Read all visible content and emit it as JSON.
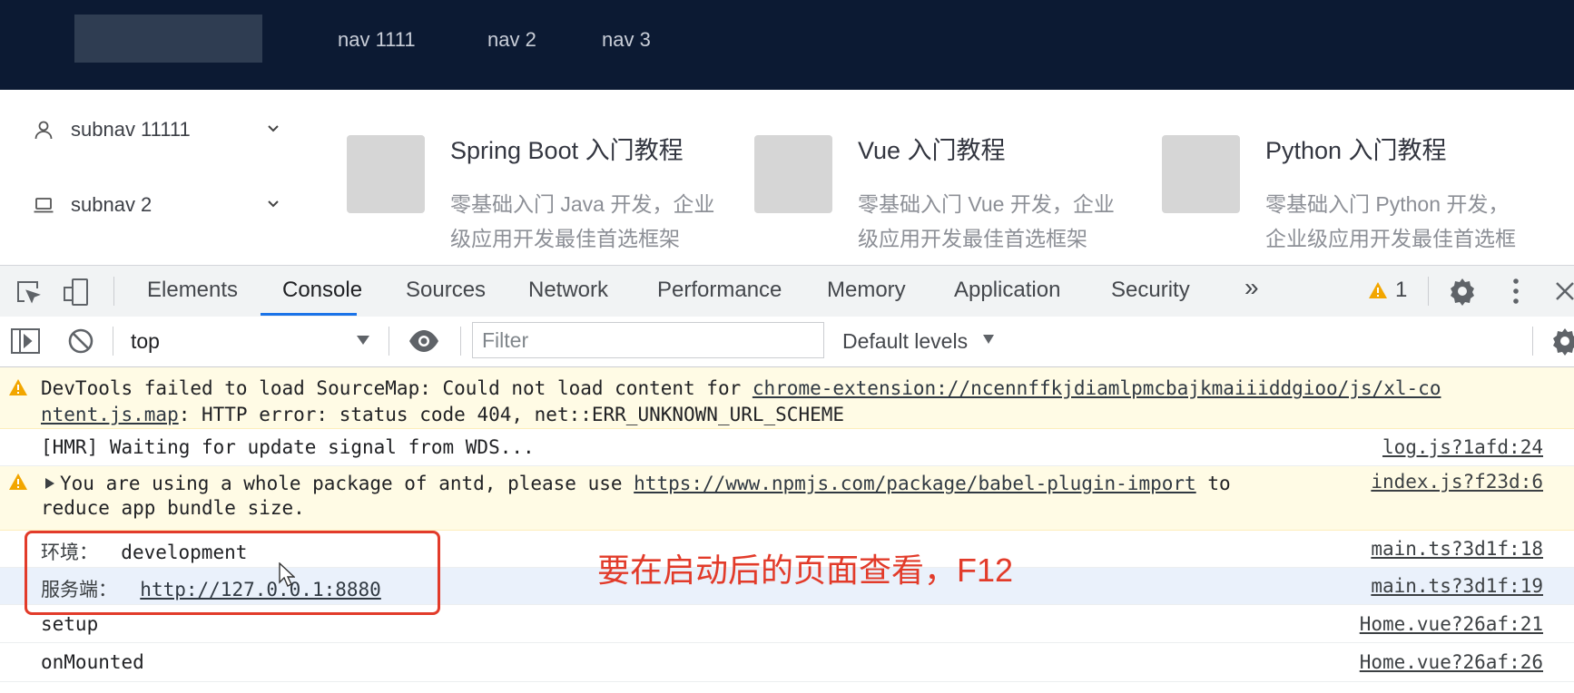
{
  "header": {
    "nav": [
      "nav 1111",
      "nav 2",
      "nav 3"
    ]
  },
  "sidebar": {
    "items": [
      {
        "label": "subnav 11111",
        "icon": "user-icon"
      },
      {
        "label": "subnav 2",
        "icon": "laptop-icon"
      }
    ]
  },
  "cards": [
    {
      "title": "Spring Boot 入门教程",
      "desc_lines": [
        "零基础入门 Java 开发，企业",
        "级应用开发最佳首选框架"
      ]
    },
    {
      "title": "Vue 入门教程",
      "desc_lines": [
        "零基础入门 Vue 开发，企业",
        "级应用开发最佳首选框架"
      ]
    },
    {
      "title": "Python 入门教程",
      "desc_lines": [
        "零基础入门 Python 开发，",
        "企业级应用开发最佳首选框"
      ]
    }
  ],
  "devtools": {
    "tabs": [
      "Elements",
      "Console",
      "Sources",
      "Network",
      "Performance",
      "Memory",
      "Application",
      "Security"
    ],
    "active_tab": "Console",
    "more_tabs": "»",
    "warning_count": "1",
    "context": "top",
    "filter_placeholder": "Filter",
    "levels": "Default levels"
  },
  "console": {
    "sourcemap": {
      "line1_prefix": "DevTools failed to load SourceMap: Could not load content for ",
      "line1_link": "chrome-extension://ncennffkjdiamlpmcbajkmaiiiddgioo/js/xl-co",
      "line2_link": "ntent.js.map",
      "line2_suffix": ": HTTP error: status code 404, net::ERR_UNKNOWN_URL_SCHEME"
    },
    "hmr": {
      "text": "[HMR] Waiting for update signal from WDS...",
      "source": "log.js?1afd:24"
    },
    "antd": {
      "prefix": "You are using a whole package of antd, please use ",
      "link": "https://www.npmjs.com/package/babel-plugin-import",
      "suffix": " to",
      "line2": "reduce app bundle size.",
      "source": "index.js?f23d:6"
    },
    "env": {
      "label": "环境：",
      "value": "development",
      "source": "main.ts?3d1f:18"
    },
    "server": {
      "label": "服务端：",
      "value": "http://127.0.0.1:8880",
      "source": "main.ts?3d1f:19"
    },
    "setup": {
      "text": "setup",
      "source": "Home.vue?26af:21"
    },
    "mounted": {
      "text": "onMounted",
      "source": "Home.vue?26af:26"
    }
  },
  "annotation": "要在启动后的页面查看，F12",
  "colors": {
    "header_bg": "#0c1a33",
    "accent": "#1a73e8",
    "annotation": "#e23b2a",
    "warn_bg": "#fffbe5"
  }
}
